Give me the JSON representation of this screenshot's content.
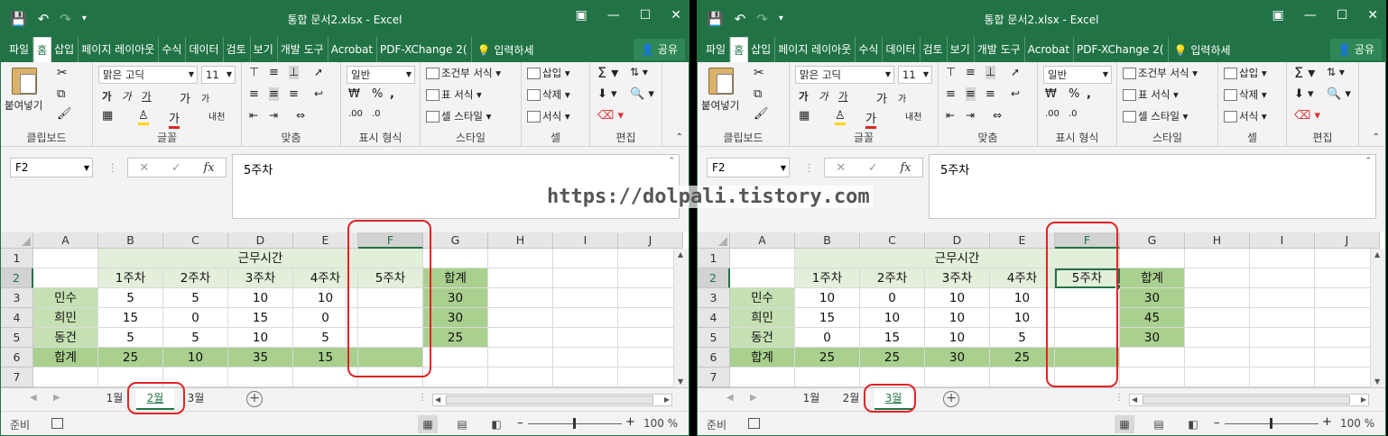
{
  "windows": [
    {
      "title": "통합 문서2.xlsx - Excel",
      "ribbon_tabs": [
        "파일",
        "홈",
        "삽입",
        "페이지 레이아웃",
        "수식",
        "데이터",
        "검토",
        "보기",
        "개발 도구",
        "Acrobat",
        "PDF-XChange 2("
      ],
      "active_tab_index": 1,
      "tell_me": "입력하세",
      "share": "공유",
      "font_name": "맑은 고딕",
      "font_size": "11",
      "number_format": "일반",
      "groups": {
        "clipboard": "클립보드",
        "font": "글꼴",
        "alignment": "맞춤",
        "number": "표시 형식",
        "styles": "스타일",
        "cells": "셀",
        "editing": "편집"
      },
      "paste": "붙여넣기",
      "styles_items": [
        "조건부 서식",
        "표 서식",
        "셀 스타일"
      ],
      "cells_items": [
        "삽입",
        "삭제",
        "서식"
      ],
      "name_box": "F2",
      "formula": "5주차",
      "columns": [
        "A",
        "B",
        "C",
        "D",
        "E",
        "F",
        "G",
        "H",
        "I",
        "J"
      ],
      "rows": [
        "1",
        "2",
        "3",
        "4",
        "5",
        "6",
        "7"
      ],
      "cells": [
        [
          "",
          "근무시간",
          "",
          "",
          "",
          "",
          "",
          "",
          "",
          ""
        ],
        [
          "",
          "1주차",
          "2주차",
          "3주차",
          "4주차",
          "5주차",
          "합계",
          "",
          "",
          ""
        ],
        [
          "민수",
          "5",
          "5",
          "10",
          "10",
          "",
          "30",
          "",
          "",
          ""
        ],
        [
          "희민",
          "15",
          "0",
          "15",
          "0",
          "",
          "30",
          "",
          "",
          ""
        ],
        [
          "동건",
          "5",
          "5",
          "10",
          "5",
          "",
          "25",
          "",
          "",
          ""
        ],
        [
          "합계",
          "25",
          "10",
          "35",
          "15",
          "",
          "",
          "",
          "",
          ""
        ],
        [
          "",
          "",
          "",
          "",
          "",
          "",
          "",
          "",
          "",
          ""
        ]
      ],
      "sheets": [
        "1월",
        "2월",
        "3월"
      ],
      "active_sheet": "2월",
      "status": "준비",
      "zoom": "100 %"
    },
    {
      "title": "통합 문서2.xlsx - Excel",
      "ribbon_tabs": [
        "파일",
        "홈",
        "삽입",
        "페이지 레이아웃",
        "수식",
        "데이터",
        "검토",
        "보기",
        "개발 도구",
        "Acrobat",
        "PDF-XChange 2("
      ],
      "active_tab_index": 1,
      "tell_me": "입력하세",
      "share": "공유",
      "font_name": "맑은 고딕",
      "font_size": "11",
      "number_format": "일반",
      "groups": {
        "clipboard": "클립보드",
        "font": "글꼴",
        "alignment": "맞춤",
        "number": "표시 형식",
        "styles": "스타일",
        "cells": "셀",
        "editing": "편집"
      },
      "paste": "붙여넣기",
      "styles_items": [
        "조건부 서식",
        "표 서식",
        "셀 스타일"
      ],
      "cells_items": [
        "삽입",
        "삭제",
        "서식"
      ],
      "name_box": "F2",
      "formula": "5주차",
      "columns": [
        "A",
        "B",
        "C",
        "D",
        "E",
        "F",
        "G",
        "H",
        "I",
        "J"
      ],
      "rows": [
        "1",
        "2",
        "3",
        "4",
        "5",
        "6",
        "7"
      ],
      "cells": [
        [
          "",
          "근무시간",
          "",
          "",
          "",
          "",
          "",
          "",
          "",
          ""
        ],
        [
          "",
          "1주차",
          "2주차",
          "3주차",
          "4주차",
          "5주차",
          "합계",
          "",
          "",
          ""
        ],
        [
          "민수",
          "10",
          "0",
          "10",
          "10",
          "",
          "30",
          "",
          "",
          ""
        ],
        [
          "희민",
          "15",
          "10",
          "10",
          "10",
          "",
          "45",
          "",
          "",
          ""
        ],
        [
          "동건",
          "0",
          "15",
          "10",
          "5",
          "",
          "30",
          "",
          "",
          ""
        ],
        [
          "합계",
          "25",
          "25",
          "30",
          "25",
          "",
          "",
          "",
          "",
          ""
        ],
        [
          "",
          "",
          "",
          "",
          "",
          "",
          "",
          "",
          "",
          ""
        ]
      ],
      "sheets": [
        "1월",
        "2월",
        "3월"
      ],
      "active_sheet": "3월",
      "status": "준비",
      "zoom": "100 %"
    }
  ],
  "watermark": "https://dolpali.tistory.com",
  "colors": {
    "excel_green": "#217346",
    "header_light": "#e2efda",
    "label_fill": "#a9d08e",
    "highlight": "#e02424"
  }
}
